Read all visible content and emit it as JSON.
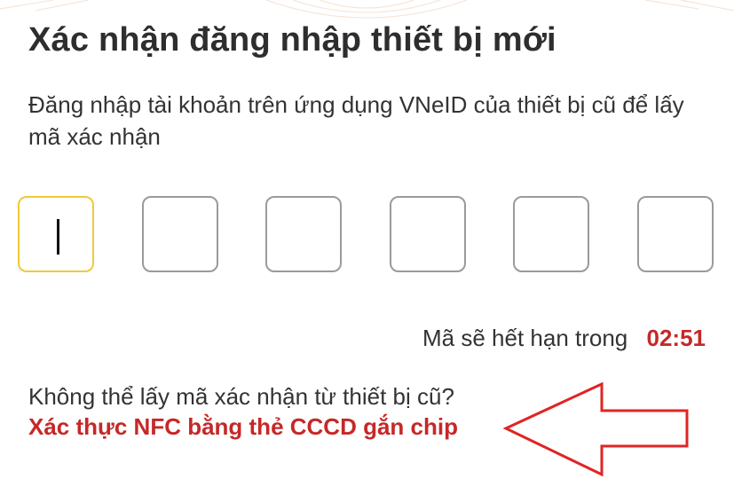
{
  "screen": {
    "title": "Xác nhận đăng nhập thiết bị mới",
    "subtitle": "Đăng nhập tài khoản trên ứng dụng VNeID của thiết bị cũ để lấy mã xác nhận"
  },
  "otp": {
    "digits": [
      "",
      "",
      "",
      "",
      "",
      ""
    ],
    "active_index": 0
  },
  "expiry": {
    "label": "Mã sẽ hết hạn trong",
    "time": "02:51"
  },
  "help": {
    "question": "Không thể lấy mã xác nhận từ thiết bị cũ?",
    "link": "Xác thực NFC bằng thẻ CCCD gắn chip"
  },
  "colors": {
    "accent_red": "#c62828",
    "active_border": "#f0c93a",
    "box_border": "#9a9a9a"
  }
}
